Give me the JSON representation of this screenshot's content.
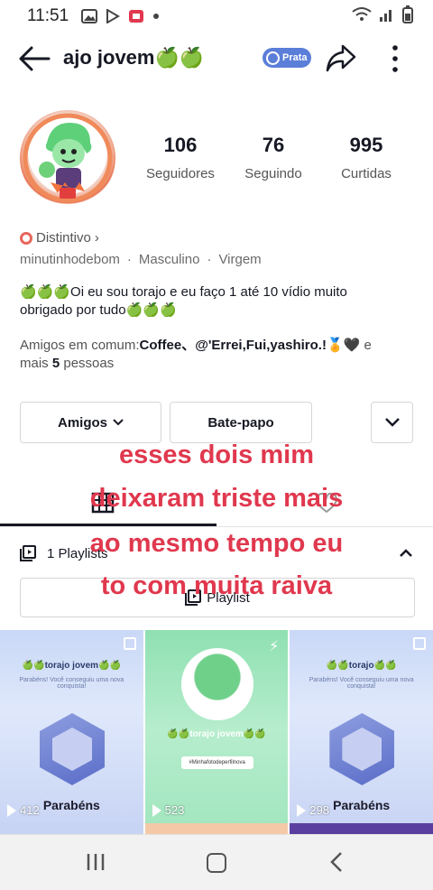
{
  "status_bar": {
    "time": "11:51"
  },
  "header": {
    "username": "ajo jovem🍏🍏",
    "badge_label": "Prata"
  },
  "stats": [
    {
      "count": "106",
      "label": "Seguidores"
    },
    {
      "count": "76",
      "label": "Seguindo"
    },
    {
      "count": "995",
      "label": "Curtidas"
    }
  ],
  "profile": {
    "distintivo_label": "Distintivo",
    "handle": "minutinhodebom",
    "gender": "Masculino",
    "sign": "Virgem",
    "bio": "🍏🍏🍏Oi eu sou torajo e eu faço 1 até 10 vídio muito obrigado por tudo🍏🍏🍏",
    "friends_prefix": "Amigos em comum:",
    "friends_names": "Coffee、@'Errei,Fui,yashiro.!🏅🖤",
    "friends_mid": " e mais ",
    "friends_count": "5",
    "friends_suffix": " pessoas"
  },
  "actions": {
    "friends_button": "Amigos",
    "chat_button": "Bate-papo"
  },
  "playlists": {
    "row_label": "1 Playlists",
    "button_label": "Playlist"
  },
  "videos": [
    {
      "title": "🍏🍏torajo jovem🍏🍏",
      "subtitle": "Parabéns! Você conseguiu uma nova conquista!",
      "label": "Parabéns",
      "views": "412"
    },
    {
      "title": "🍏🍏torajo jovem🍏🍏",
      "subtitle": "#Minhafotodeperfilnova",
      "label": "",
      "views": "523"
    },
    {
      "title": "🍏🍏torajo🍏🍏",
      "subtitle": "Parabéns! Você conseguiu uma nova conquista!",
      "label": "Parabéns",
      "views": "298"
    }
  ],
  "caption_lines": [
    "esses dois mim",
    "deixaram triste mais",
    "ao mesmo tempo eu",
    "to com muita raiva"
  ],
  "colors": {
    "caption": "#e0384e",
    "badge": "#5b7ed8",
    "accent_ring": "#f08a5a"
  }
}
